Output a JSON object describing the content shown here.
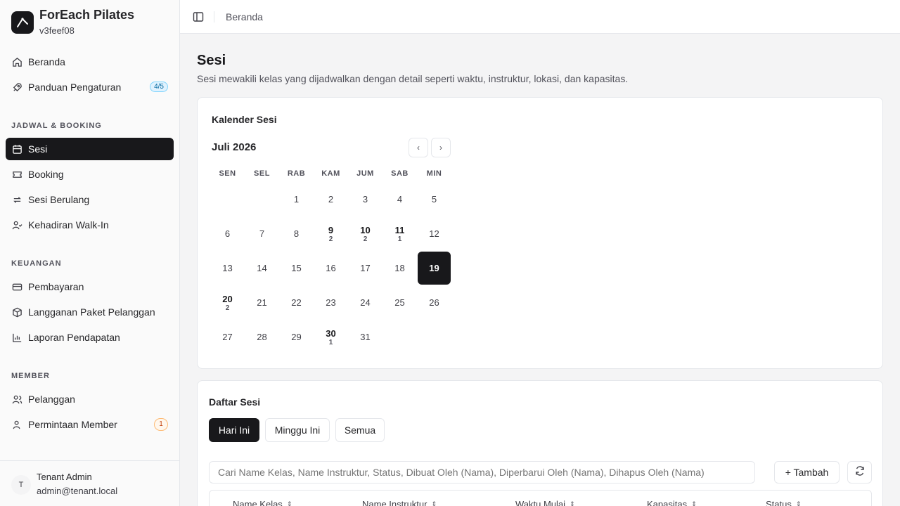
{
  "brand": {
    "name": "ForEach Pilates",
    "version": "v3feef08"
  },
  "nav": {
    "home": "Beranda",
    "setup_guide": "Panduan Pengaturan",
    "setup_badge": "4/5",
    "section_schedule": "JADWAL & BOOKING",
    "sessions": "Sesi",
    "booking": "Booking",
    "recurring": "Sesi Berulang",
    "walkin": "Kehadiran Walk-In",
    "section_finance": "KEUANGAN",
    "payments": "Pembayaran",
    "subscriptions": "Langganan Paket Pelanggan",
    "revenue": "Laporan Pendapatan",
    "section_member": "MEMBER",
    "customers": "Pelanggan",
    "member_requests": "Permintaan Member",
    "member_badge": "1"
  },
  "user": {
    "initial": "T",
    "name": "Tenant Admin",
    "email": "admin@tenant.local"
  },
  "topbar": {
    "breadcrumb": "Beranda"
  },
  "page": {
    "title": "Sesi",
    "description": "Sesi mewakili kelas yang dijadwalkan dengan detail seperti waktu, instruktur, lokasi, dan kapasitas."
  },
  "calendar": {
    "title": "Kalender Sesi",
    "month": "Juli 2026",
    "prev": "‹",
    "next": "›",
    "weekdays": [
      "SEN",
      "SEL",
      "RAB",
      "KAM",
      "JUM",
      "SAB",
      "MIN"
    ],
    "first_weekday_index": 2,
    "days_in_month": 31,
    "selected_day": 19,
    "session_counts": {
      "9": 2,
      "10": 2,
      "11": 1,
      "20": 2,
      "30": 1
    }
  },
  "list": {
    "title": "Daftar Sesi",
    "tabs": [
      "Hari Ini",
      "Minggu Ini",
      "Semua"
    ],
    "active_tab": 0,
    "search_placeholder": "Cari Name Kelas, Name Instruktur, Status, Dibuat Oleh (Nama), Diperbarui Oleh (Nama), Dihapus Oleh (Nama)",
    "add_label": "+ Tambah",
    "columns": [
      "Name Kelas",
      "Name Instruktur",
      "Waktu Mulai",
      "Kapasitas",
      "Status"
    ]
  }
}
